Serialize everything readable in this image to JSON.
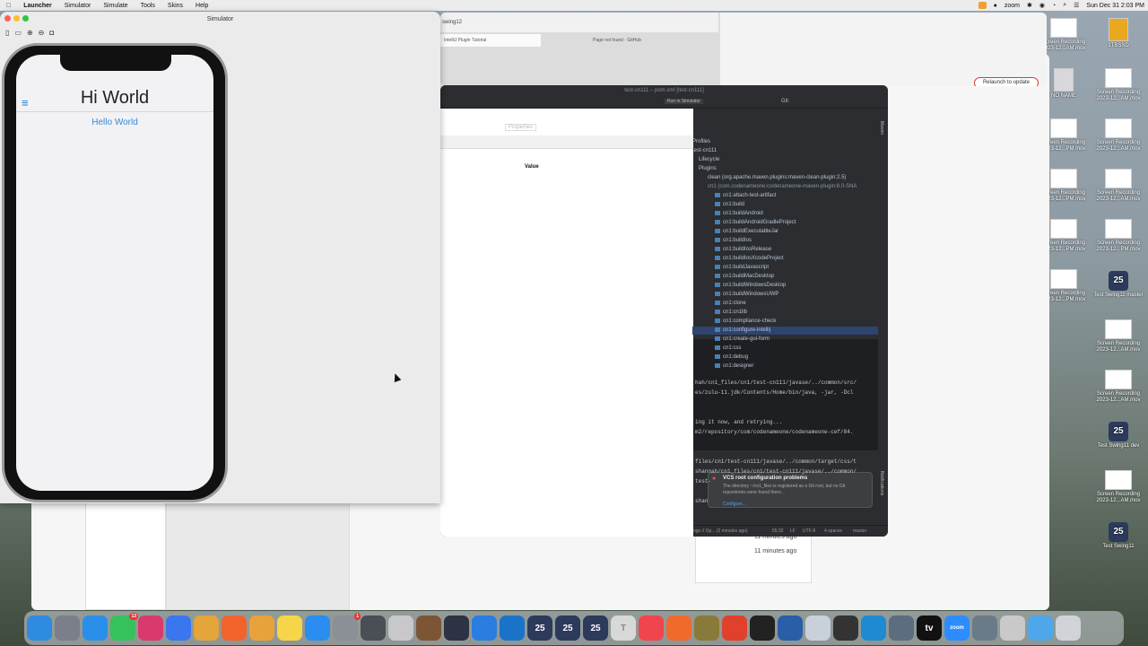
{
  "menubar": {
    "app": "Launcher",
    "items": [
      "Simulator",
      "Simulate",
      "Tools",
      "Skins",
      "Help"
    ],
    "zoom": "zoom",
    "clock": "Sun Dec 31  2:03 PM"
  },
  "desktop": [
    {
      "label": "Screen Recording 2023-12...AM.mov",
      "dark": false
    },
    {
      "label": "1TBSSD",
      "dark": false
    },
    {
      "label": "NO NAME",
      "dark": false
    },
    {
      "label": "Screen Recording 2023-12...AM.mov",
      "dark": false
    },
    {
      "label": "Screen Recording 2023-12...PM.mov",
      "dark": false
    },
    {
      "label": "Screen Recording 2023-12...AM.mov",
      "dark": false
    },
    {
      "label": "Screen Recording 2023-12...PM.mov",
      "dark": false
    },
    {
      "label": "Screen Recording 2023-12...AM.mov",
      "dark": false
    },
    {
      "label": "Screen Recording 2023-12...PM.mov",
      "dark": false
    },
    {
      "label": "Screen Recording 2023-12...PM.mov",
      "dark": false
    },
    {
      "label": "Screen Recording 2023-12...PM.mov",
      "dark": false
    },
    {
      "label": "Test Swing11 master",
      "dark": false
    },
    {
      "label": "Screen Recording 2023-12...AM.mov",
      "dark": false
    },
    {
      "label": "Screen Recording 2023-12...AM.mov",
      "dark": false
    },
    {
      "label": "Test Swing11 dev",
      "dark": false
    },
    {
      "label": "Screen Recording 2023-12...AM.mov",
      "dark": false
    },
    {
      "label": "Test Swing11",
      "dark": false
    }
  ],
  "browser": {
    "tab1": "swing12",
    "tab2": "IntelliJ Plugin Tutorial",
    "tab3": "Page not found · GitHub",
    "relaunch": "Relaunch to update"
  },
  "ide": {
    "title": "test-cn111 – pom.xml [test-cn111]",
    "run_config": "Run in Simulator",
    "git": "Git:",
    "maven_label": "Maven",
    "properties_tab": "Properties",
    "value_header": "Value",
    "tree": [
      "Profiles",
      "test-cn111",
      "Lifecycle",
      "Plugins",
      "clean (org.apache.maven.plugins:maven-clean-plugin:2.5)",
      "cn1 (com.codenameone:codenameone-maven-plugin:8.0-SNA"
    ],
    "goals": [
      "cn1:attach-test-artifact",
      "cn1:build",
      "cn1:buildAndroid",
      "cn1:buildAndroidGradleProject",
      "cn1:buildExecutableJar",
      "cn1:buildIos",
      "cn1:buildIosRelease",
      "cn1:buildIosXcodeProject",
      "cn1:buildJavascript",
      "cn1:buildMacDesktop",
      "cn1:buildWindowsDesktop",
      "cn1:buildWindowsUWP",
      "cn1:clone",
      "cn1:cn1lib",
      "cn1:compliance-check",
      "cn1:configure-intellij",
      "cn1:create-gui-form",
      "cn1:css",
      "cn1:debug",
      "cn1:designer"
    ],
    "console": [
      "hah/cn1_files/cn1/test-cn111/javase/../common/src/",
      "es/zulu-11.jdk/Contents/Home/bin/java, -jar, -Dcl",
      "",
      "ing it now, and retrying...",
      "m2/repository/com/codenameone/codenameone-cef/84.",
      "",
      "",
      "files/cn1/test-cn111/javase/../common/target/css/t",
      "shannah/cn1_files/cn1/test-cn111/javase/../common/",
      "test-",
      "",
      "shan"
    ],
    "notification_title": "VCS root configuration problems",
    "notification_body": "The directory ~/cn1_files is registered as a Git root, but no Git repositories were found there...",
    "notification_link": "Configure...",
    "notifications_label": "Notifications",
    "status_left": "ngs // Op... (2 minutes ago)",
    "status_pos": "55:32",
    "status_lf": "LF",
    "status_enc": "UTF-8",
    "status_indent": "4 spaces",
    "status_branch": "master"
  },
  "behind": {
    "ago1": "11 minutes ago",
    "ago2": "11 minutes ago"
  },
  "simulator": {
    "title": "Simulator",
    "app_title": "Hi World",
    "hamburger": "≡",
    "label": "Hello World"
  },
  "dock": [
    {
      "name": "finder",
      "color": "#2f8be0"
    },
    {
      "name": "launchpad",
      "color": "#7a7f8a"
    },
    {
      "name": "safari",
      "color": "#2a8fe8"
    },
    {
      "name": "messages",
      "color": "#36c25a"
    },
    {
      "name": "intellij",
      "color": "#d9396b"
    },
    {
      "name": "signal",
      "color": "#3a76f0"
    },
    {
      "name": "chrome",
      "color": "#e4a53b"
    },
    {
      "name": "brave",
      "color": "#f0642c"
    },
    {
      "name": "photos",
      "color": "#e8a23c"
    },
    {
      "name": "notes",
      "color": "#f6d54a"
    },
    {
      "name": "appstore",
      "color": "#2b8df0"
    },
    {
      "name": "settings",
      "color": "#8b8f96"
    },
    {
      "name": "vectorworks",
      "color": "#4a4e55"
    },
    {
      "name": "scrivener",
      "color": "#c8c8cc"
    },
    {
      "name": "tool-a",
      "color": "#7c5634"
    },
    {
      "name": "wunderbucket",
      "color": "#2d3344"
    },
    {
      "name": "xcode",
      "color": "#2a7de1"
    },
    {
      "name": "vscode-x",
      "color": "#1a73c8"
    },
    {
      "name": "cn1-a",
      "color": "#2c3a5c"
    },
    {
      "name": "cn1-b",
      "color": "#2c3a5c"
    },
    {
      "name": "cn1-c",
      "color": "#2c3a5c"
    },
    {
      "name": "textedit",
      "color": "#d8d8d8"
    },
    {
      "name": "music",
      "color": "#f2444c"
    },
    {
      "name": "swift",
      "color": "#f06a2c"
    },
    {
      "name": "hay",
      "color": "#8a7a3a"
    },
    {
      "name": "devonthink",
      "color": "#e0402c"
    },
    {
      "name": "terminal",
      "color": "#222"
    },
    {
      "name": "vpn",
      "color": "#2a5ea8"
    },
    {
      "name": "script",
      "color": "#c8d0da"
    },
    {
      "name": "console",
      "color": "#333"
    },
    {
      "name": "vscode",
      "color": "#1f8ad2"
    },
    {
      "name": "preview",
      "color": "#5c6d7f"
    },
    {
      "name": "tv",
      "color": "#111"
    },
    {
      "name": "zoom",
      "color": "#2d8cff"
    },
    {
      "name": "screenshot",
      "color": "#6a7a88"
    },
    {
      "name": "automator",
      "color": "#c9c9c9"
    },
    {
      "name": "downloads",
      "color": "#4fa6e8"
    },
    {
      "name": "trash",
      "color": "#d0d4d8"
    }
  ],
  "dock_labels": {
    "messages_badge": "13",
    "settings_badge": "1",
    "tv": "tv",
    "zoom": "zoom",
    "cn1": "25",
    "text": "T"
  }
}
